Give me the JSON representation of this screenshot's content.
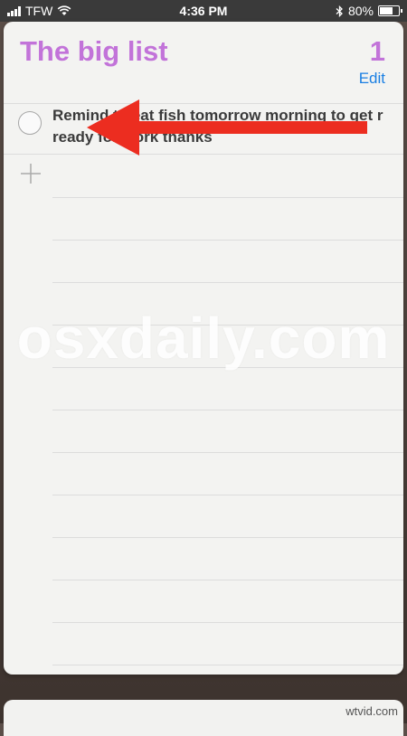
{
  "status_bar": {
    "carrier": "TFW",
    "time": "4:36 PM",
    "battery": "80%",
    "battery_level": 0.8,
    "icons": [
      "signal-bars-icon",
      "wifi-icon",
      "bluetooth-icon",
      "battery-icon"
    ]
  },
  "list": {
    "title": "The big list",
    "count": "1",
    "edit_label": "Edit",
    "title_color": "#c273d9",
    "edit_color": "#1a7fe3"
  },
  "reminders": [
    {
      "text": "Remind    to eat fish tomorrow morning to get    r ready for work thanks",
      "completed": false
    }
  ],
  "annotations": {
    "arrow_color": "#ec2d20",
    "watermark": "osxdaily.com"
  },
  "footer": {
    "site_stamp": "wtvid.com"
  }
}
